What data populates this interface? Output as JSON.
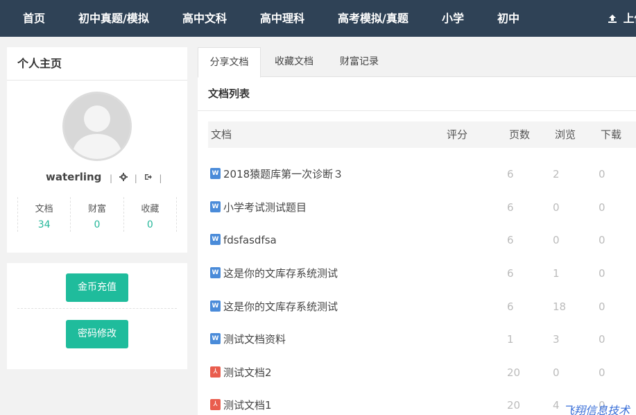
{
  "nav": {
    "items": [
      "首页",
      "初中真题/模拟",
      "高中文科",
      "高中理科",
      "高考模拟/真题",
      "小学",
      "初中"
    ],
    "upload_label": "上传"
  },
  "profile": {
    "title": "个人主页",
    "username": "waterling",
    "tools": [
      "gear-icon",
      "sign-out-icon"
    ],
    "stats": [
      {
        "label": "文档",
        "value": "34"
      },
      {
        "label": "财富",
        "value": "0"
      },
      {
        "label": "收藏",
        "value": "0"
      }
    ]
  },
  "actions": {
    "recharge_label": "金币充值",
    "password_label": "密码修改"
  },
  "tabs": [
    {
      "label": "分享文档",
      "active": true
    },
    {
      "label": "收藏文档",
      "active": false
    },
    {
      "label": "财富记录",
      "active": false
    }
  ],
  "list": {
    "title": "文档列表",
    "columns": [
      "文档",
      "评分",
      "页数",
      "浏览",
      "下载"
    ],
    "rows": [
      {
        "type": "word",
        "name": "2018猿题库第一次诊断３",
        "score": "",
        "pages": "6",
        "views": "2",
        "downloads": "0"
      },
      {
        "type": "word",
        "name": "小学考试测试题目",
        "score": "",
        "pages": "6",
        "views": "0",
        "downloads": "0"
      },
      {
        "type": "word",
        "name": "fdsfasdfsa",
        "score": "",
        "pages": "6",
        "views": "0",
        "downloads": "0"
      },
      {
        "type": "word",
        "name": "这是你的文库存系统测试",
        "score": "",
        "pages": "6",
        "views": "1",
        "downloads": "0"
      },
      {
        "type": "word",
        "name": "这是你的文库存系统测试",
        "score": "",
        "pages": "6",
        "views": "18",
        "downloads": "0"
      },
      {
        "type": "word",
        "name": "测试文档资料",
        "score": "",
        "pages": "1",
        "views": "3",
        "downloads": "0"
      },
      {
        "type": "pdf",
        "name": "测试文档2",
        "score": "",
        "pages": "20",
        "views": "0",
        "downloads": "0"
      },
      {
        "type": "pdf",
        "name": "测试文档1",
        "score": "",
        "pages": "20",
        "views": "4",
        "downloads": "0"
      }
    ]
  },
  "watermark": "飞翔信息技术",
  "colors": {
    "nav_bg": "#2f4256",
    "accent": "#1fbc9c",
    "stat_value": "#26b79a",
    "word_icon": "#4a8bd9",
    "pdf_icon": "#e95d4e"
  }
}
